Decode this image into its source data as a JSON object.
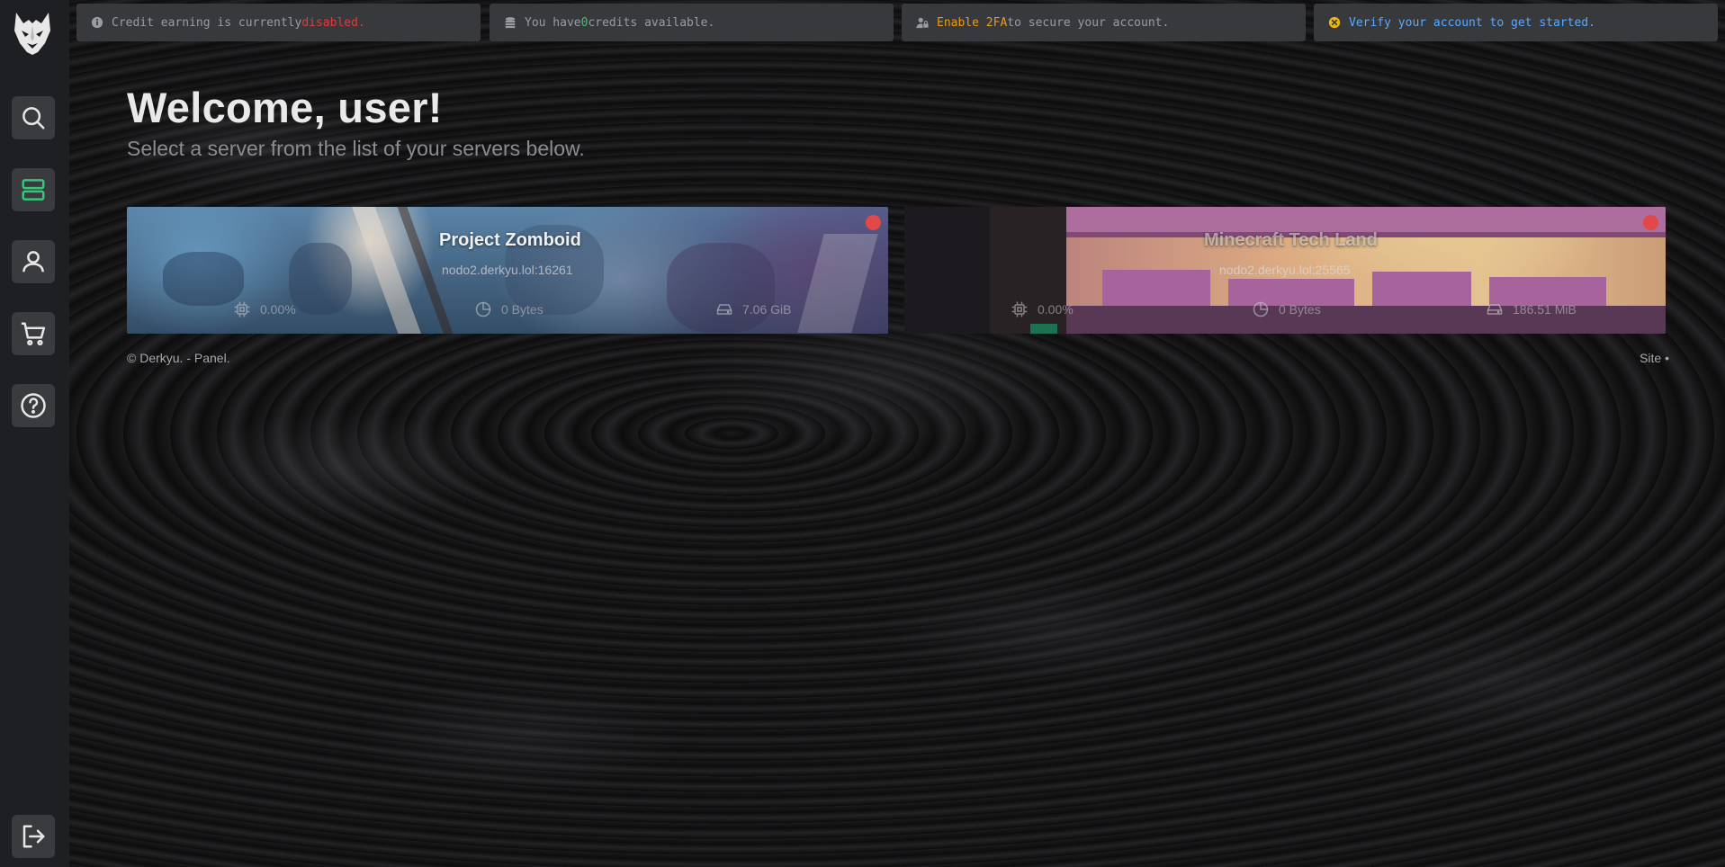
{
  "alerts": [
    {
      "icon": "info-circle-icon",
      "prefix": "Credit earning is currently ",
      "highlight": "disabled.",
      "suffix": "",
      "color": "#e03c3c"
    },
    {
      "icon": "coins-icon",
      "prefix": "You have ",
      "highlight": "0",
      "suffix": " credits available.",
      "color": "#34c77b"
    },
    {
      "icon": "user-lock-icon",
      "prefix": "",
      "highlight": "Enable 2FA",
      "suffix": " to secure your account.",
      "color": "#e69a1e"
    },
    {
      "icon": "x-circle-icon",
      "prefix": "",
      "highlight": "Verify your account to get started.",
      "suffix": "",
      "color": "#5aa9ff"
    }
  ],
  "sidebar": {
    "items": [
      {
        "icon": "search-icon"
      },
      {
        "icon": "servers-icon",
        "active": true,
        "active_color": "#34c77b"
      },
      {
        "icon": "user-icon"
      },
      {
        "icon": "cart-icon"
      },
      {
        "icon": "help-icon"
      }
    ],
    "logout_icon": "logout-icon"
  },
  "welcome": {
    "title": "Welcome, user!",
    "subtitle": "Select a server from the list of your servers below."
  },
  "servers": [
    {
      "name": "Project Zomboid",
      "address": "nodo2.derkyu.lol:16261",
      "cpu": "0.00%",
      "memory": "0 Bytes",
      "disk": "7.06 GiB",
      "status_color": "#e34848"
    },
    {
      "name": "Minecraft Tech Land",
      "address": "nodo2.derkyu.lol:25565",
      "cpu": "0.00%",
      "memory": "0 Bytes",
      "disk": "186.51 MiB",
      "status_color": "#e34848"
    }
  ],
  "footer": {
    "copyright": "© Derkyu. - Panel.",
    "site_link": "Site •"
  }
}
